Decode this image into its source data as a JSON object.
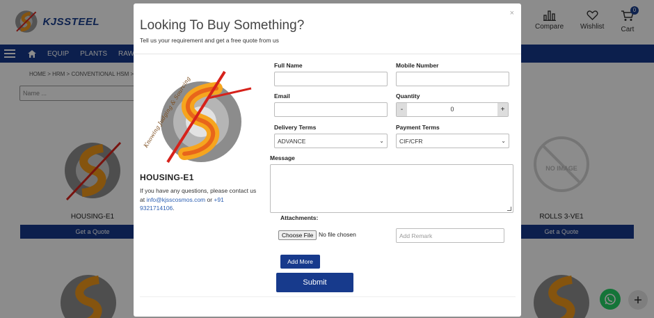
{
  "brand": {
    "name": "KJSSTEEL"
  },
  "header_icons": [
    {
      "label": "Compare",
      "icon": "bar-chart-icon"
    },
    {
      "label": "Wishlist",
      "icon": "heart-icon"
    },
    {
      "label": "Cart",
      "icon": "cart-icon",
      "badge": "0"
    }
  ],
  "nav": {
    "items": [
      "EQUIP",
      "PLANTS",
      "RAW"
    ],
    "icon": "home-icon"
  },
  "breadcrumb": "HOME > HRM > CONVENTIONAL HSM > ",
  "filter": {
    "placeholder": "Name ..."
  },
  "products": [
    {
      "title": "HOUSING-E1",
      "button": "Get a Quote"
    },
    {
      "title": "ROLLS 3-VE1",
      "button": "Get a Quote",
      "placeholder_text": "NO IMAGE"
    }
  ],
  "modal": {
    "close": "×",
    "title": "Looking To Buy Something?",
    "subtitle": "Tell us your requirement and get a free quote from us",
    "product_name": "HOUSING-E1",
    "contact_prefix": "If you have any questions, please contact us at ",
    "contact_email": "info@kjsscosmos.com",
    "contact_mid": " or ",
    "contact_phone": "+91 9321714106",
    "contact_suffix": ".",
    "logo_tagline": "Knowing Judging & Sourcing",
    "fields": {
      "full_name_label": "Full Name",
      "mobile_label": "Mobile Number",
      "email_label": "Email",
      "quantity_label": "Quantity",
      "quantity_value": "0",
      "quantity_minus": "-",
      "quantity_plus": "+",
      "delivery_label": "Delivery Terms",
      "delivery_value": "ADVANCE",
      "payment_label": "Payment Terms",
      "payment_value": "CIF/CFR",
      "message_label": "Message",
      "attachments_label": "Attachments:",
      "choose_file": "Choose File",
      "no_file": "No file chosen",
      "remark_placeholder": "Add Remark"
    },
    "add_more": "Add More",
    "submit": "Submit"
  },
  "colors": {
    "primary": "#173a8c",
    "whatsapp": "#25d366"
  }
}
